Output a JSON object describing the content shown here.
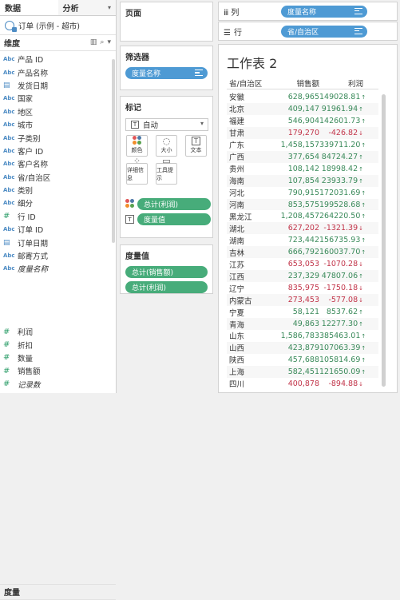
{
  "tabs": [
    {
      "label": "数据"
    },
    {
      "label": "分析"
    }
  ],
  "datasource": "订单 (示例 - 超市)",
  "dimensions": {
    "title": "维度",
    "fields": [
      {
        "type": "Abc",
        "name": "产品 ID"
      },
      {
        "type": "Abc",
        "name": "产品名称"
      },
      {
        "type": "cal",
        "name": "发货日期"
      },
      {
        "type": "Abc",
        "name": "国家"
      },
      {
        "type": "Abc",
        "name": "地区"
      },
      {
        "type": "Abc",
        "name": "城市"
      },
      {
        "type": "Abc",
        "name": "子类别"
      },
      {
        "type": "Abc",
        "name": "客户 ID"
      },
      {
        "type": "Abc",
        "name": "客户名称"
      },
      {
        "type": "Abc",
        "name": "省/自治区"
      },
      {
        "type": "Abc",
        "name": "类别"
      },
      {
        "type": "Abc",
        "name": "细分"
      },
      {
        "type": "#",
        "name": "行 ID"
      },
      {
        "type": "Abc",
        "name": "订单 ID"
      },
      {
        "type": "cal",
        "name": "订单日期"
      },
      {
        "type": "Abc",
        "name": "邮寄方式"
      },
      {
        "type": "Abc",
        "name": "度量名称",
        "italic": true
      }
    ]
  },
  "measures": {
    "title": "度量",
    "fields": [
      {
        "type": "#",
        "name": "利润"
      },
      {
        "type": "#",
        "name": "折扣"
      },
      {
        "type": "#",
        "name": "数量"
      },
      {
        "type": "#",
        "name": "销售额"
      },
      {
        "type": "#",
        "name": "记录数",
        "italic": true
      }
    ]
  },
  "pages": {
    "title": "页面"
  },
  "filters": {
    "title": "筛选器",
    "pill": "度量名称"
  },
  "marks": {
    "title": "标记",
    "type_label": "自动",
    "type_icon": "T",
    "buttons": [
      {
        "label": "颜色",
        "icon": "color-dots-icon"
      },
      {
        "label": "大小",
        "icon": "size-icon",
        "glyph": "◌"
      },
      {
        "label": "文本",
        "icon": "text-icon",
        "glyph": "T"
      },
      {
        "label": "详细信息",
        "icon": "detail-icon",
        "glyph": "⁘"
      },
      {
        "label": "工具提示",
        "icon": "tooltip-icon",
        "glyph": "▭"
      }
    ],
    "pills": [
      {
        "label": "总计(利润)"
      },
      {
        "label": "度量值"
      }
    ]
  },
  "measure_values": {
    "title": "度量值",
    "pills": [
      {
        "label": "总计(销售额)"
      },
      {
        "label": "总计(利润)"
      }
    ]
  },
  "columns_shelf": {
    "label": "列",
    "icon": "iii",
    "pill": "度量名称"
  },
  "rows_shelf": {
    "label": "行",
    "icon": "☰",
    "pill": "省/自治区"
  },
  "sheet": {
    "title": "工作表 2",
    "headers": [
      "省/自治区",
      "销售额",
      "利润"
    ],
    "rows": [
      {
        "prov": "安徽",
        "sales": "628,965",
        "profit": "149028.81",
        "neg": false
      },
      {
        "prov": "北京",
        "sales": "409,147",
        "profit": "91961.94",
        "neg": false
      },
      {
        "prov": "福建",
        "sales": "546,904",
        "profit": "142601.73",
        "neg": false
      },
      {
        "prov": "甘肃",
        "sales": "179,270",
        "profit": "-426.82",
        "neg": true
      },
      {
        "prov": "广东",
        "sales": "1,458,157",
        "profit": "339711.20",
        "neg": false
      },
      {
        "prov": "广西",
        "sales": "377,654",
        "profit": "84724.27",
        "neg": false
      },
      {
        "prov": "贵州",
        "sales": "108,142",
        "profit": "18998.42",
        "neg": false
      },
      {
        "prov": "海南",
        "sales": "107,854",
        "profit": "23933.79",
        "neg": false
      },
      {
        "prov": "河北",
        "sales": "790,915",
        "profit": "172031.69",
        "neg": false
      },
      {
        "prov": "河南",
        "sales": "853,575",
        "profit": "199528.68",
        "neg": false
      },
      {
        "prov": "黑龙江",
        "sales": "1,208,457",
        "profit": "264220.50",
        "neg": false
      },
      {
        "prov": "湖北",
        "sales": "627,202",
        "profit": "-1321.39",
        "neg": true
      },
      {
        "prov": "湖南",
        "sales": "723,442",
        "profit": "156735.93",
        "neg": false
      },
      {
        "prov": "吉林",
        "sales": "666,792",
        "profit": "160037.70",
        "neg": false
      },
      {
        "prov": "江苏",
        "sales": "653,053",
        "profit": "-1070.28",
        "neg": true
      },
      {
        "prov": "江西",
        "sales": "237,329",
        "profit": "47807.06",
        "neg": false
      },
      {
        "prov": "辽宁",
        "sales": "835,975",
        "profit": "-1750.18",
        "neg": true
      },
      {
        "prov": "内蒙古",
        "sales": "273,453",
        "profit": "-577.08",
        "neg": true
      },
      {
        "prov": "宁夏",
        "sales": "58,121",
        "profit": "8537.62",
        "neg": false
      },
      {
        "prov": "青海",
        "sales": "49,863",
        "profit": "12277.30",
        "neg": false
      },
      {
        "prov": "山东",
        "sales": "1,586,783",
        "profit": "385463.01",
        "neg": false
      },
      {
        "prov": "山西",
        "sales": "423,879",
        "profit": "107063.39",
        "neg": false
      },
      {
        "prov": "陕西",
        "sales": "457,688",
        "profit": "105814.69",
        "neg": false
      },
      {
        "prov": "上海",
        "sales": "582,451",
        "profit": "121650.09",
        "neg": false
      },
      {
        "prov": "四川",
        "sales": "400,878",
        "profit": "-894.88",
        "neg": true
      }
    ]
  },
  "colors": {
    "pill_blue": "#4e9ad4",
    "pill_green": "#47ac7a",
    "positive": "#3a8a5a",
    "negative": "#c2354a",
    "color_dots": [
      "#e15759",
      "#4e79a7",
      "#f28e2b",
      "#59a14f"
    ]
  }
}
